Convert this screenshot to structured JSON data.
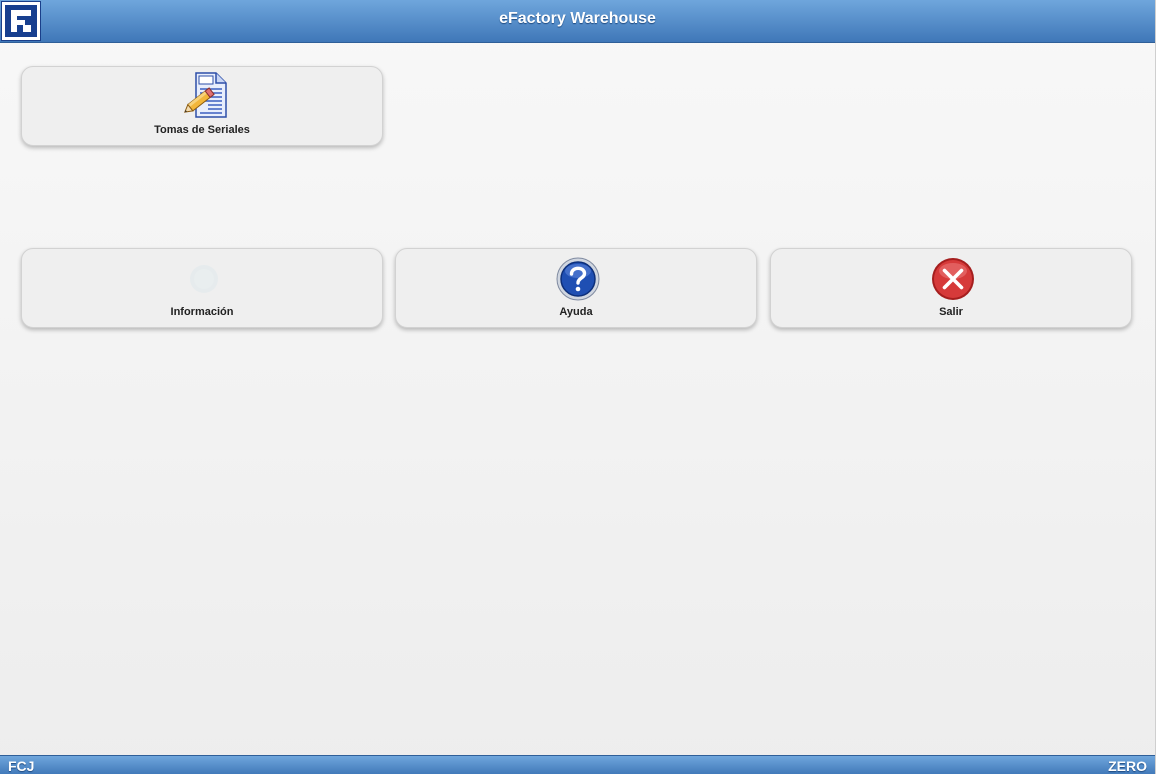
{
  "header": {
    "title": "eFactory Warehouse",
    "logo_icon": "efactory-logo-icon"
  },
  "tiles": [
    {
      "label": "Tomas de Seriales",
      "icon": "document-pencil-icon"
    },
    {
      "label": "Información",
      "icon": "info-icon"
    },
    {
      "label": "Ayuda",
      "icon": "help-icon"
    },
    {
      "label": "Salir",
      "icon": "close-icon"
    }
  ],
  "footer": {
    "left": "FCJ",
    "right": "ZERO"
  },
  "colors": {
    "header_top": "#6fa6dc",
    "header_bottom": "#3f77b8",
    "tile_bg": "#efefef",
    "help_blue": "#1f4fb3",
    "exit_red": "#d63a3a"
  }
}
